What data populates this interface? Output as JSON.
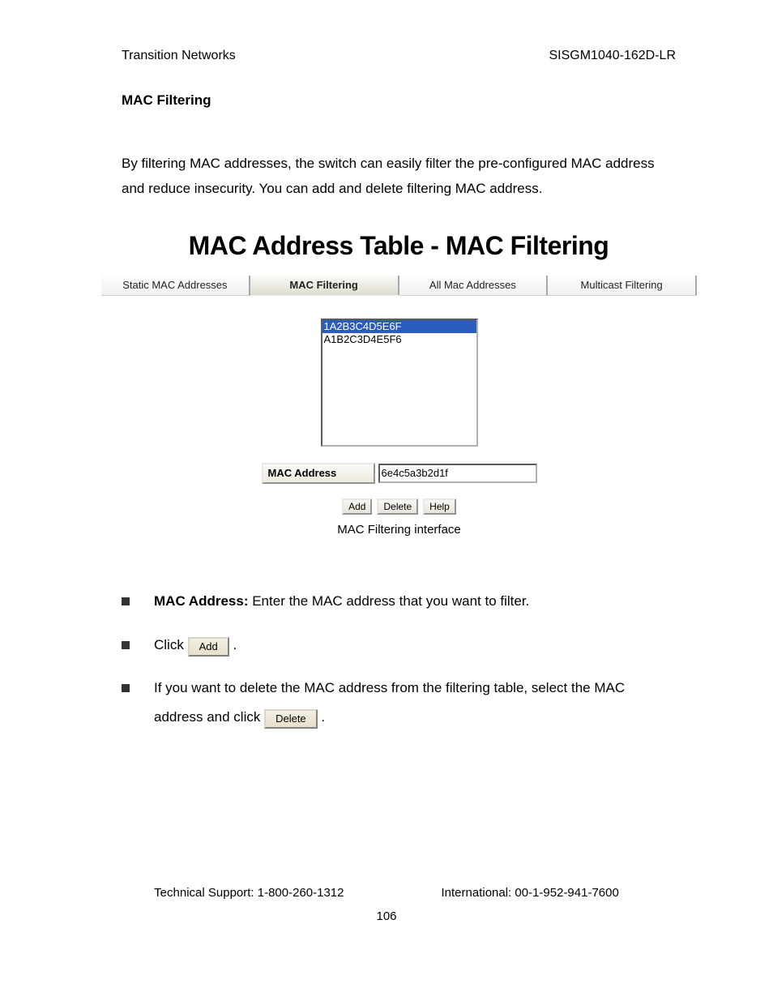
{
  "header": {
    "left": "Transition Networks",
    "right": "SISGM1040-162D-LR"
  },
  "section": {
    "title": "MAC Filtering",
    "intro": "By filtering MAC addresses, the switch can easily filter the pre-configured MAC address and reduce insecurity. You can add and delete filtering MAC address."
  },
  "figure": {
    "heading": "MAC Address Table - MAC Filtering",
    "tabs": [
      {
        "label": "Static MAC Addresses",
        "active": false
      },
      {
        "label": "MAC Filtering",
        "active": true
      },
      {
        "label": "All Mac Addresses",
        "active": false
      },
      {
        "label": "Multicast Filtering",
        "active": false
      }
    ],
    "listbox": [
      {
        "value": "1A2B3C4D5E6F",
        "selected": true
      },
      {
        "value": "A1B2C3D4E5F6",
        "selected": false
      }
    ],
    "mac_label": "MAC Address",
    "mac_value": "6e4c5a3b2d1f",
    "buttons": {
      "add": "Add",
      "delete": "Delete",
      "help": "Help"
    },
    "caption": "MAC Filtering interface"
  },
  "bullets": {
    "b1_label": "MAC Address:",
    "b1_text": " Enter the MAC address that you want to filter.",
    "b2_pre": "Click  ",
    "b2_btn": "Add",
    "b2_post": " .",
    "b3_pre": "If you want to delete the MAC address from the filtering table, select the MAC address and click  ",
    "b3_btn": "Delete",
    "b3_post": " ."
  },
  "footer": {
    "left": "Technical Support: 1-800-260-1312",
    "right": "International: 00-1-952-941-7600",
    "page": "106"
  }
}
